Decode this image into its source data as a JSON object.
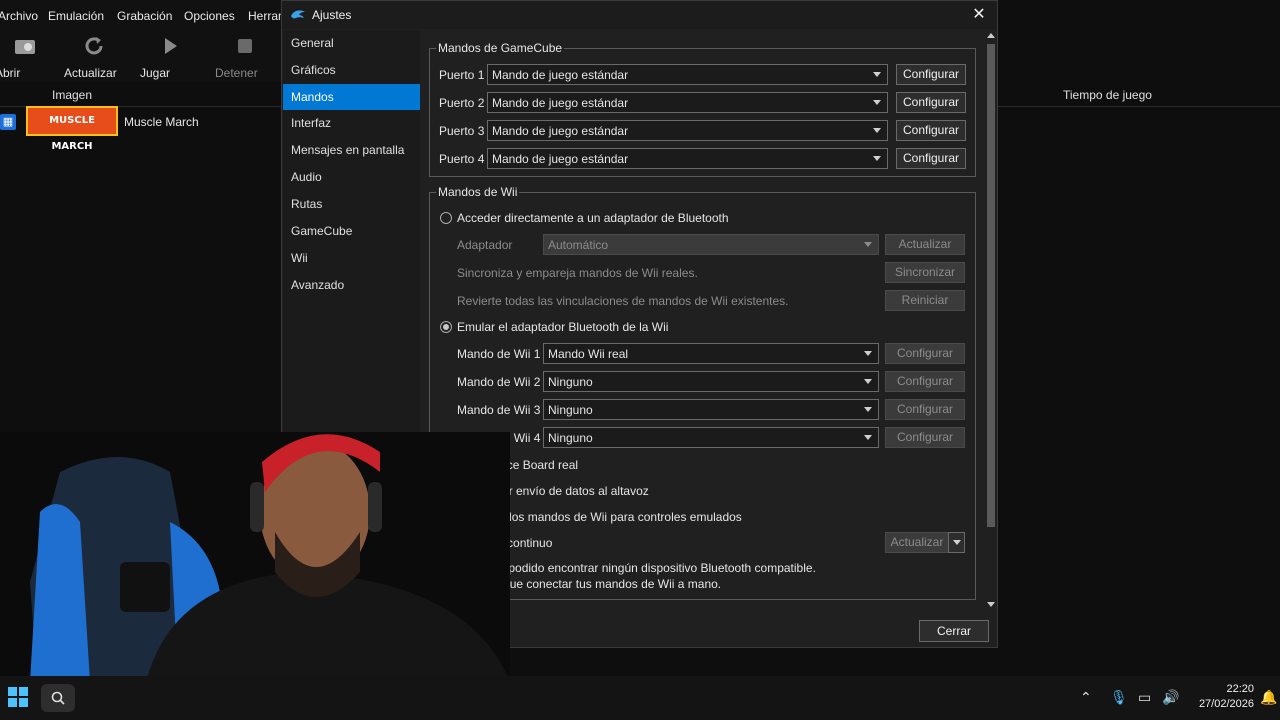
{
  "main_window": {
    "menu": [
      "Archivo",
      "Emulación",
      "Grabación",
      "Opciones",
      "Herram"
    ],
    "toolbar": {
      "open": "Abrir",
      "refresh": "Actualizar",
      "play": "Jugar",
      "stop": "Detener"
    },
    "columns": {
      "image": "Imagen",
      "playtime": "Tiempo de juego"
    },
    "game": {
      "banner_text": "MUSCLE MARCH",
      "title": "Muscle March"
    }
  },
  "dialog": {
    "title": "Ajustes",
    "nav": [
      "General",
      "Gráficos",
      "Mandos",
      "Interfaz",
      "Mensajes en pantalla",
      "Audio",
      "Rutas",
      "GameCube",
      "Wii",
      "Avanzado"
    ],
    "selected_nav": "Mandos",
    "gamecube": {
      "title": "Mandos de GameCube",
      "ports": [
        {
          "label": "Puerto 1",
          "value": "Mando de juego estándar",
          "button": "Configurar"
        },
        {
          "label": "Puerto 2",
          "value": "Mando de juego estándar",
          "button": "Configurar"
        },
        {
          "label": "Puerto 3",
          "value": "Mando de juego estándar",
          "button": "Configurar"
        },
        {
          "label": "Puerto 4",
          "value": "Mando de juego estándar",
          "button": "Configurar"
        }
      ]
    },
    "wii": {
      "title": "Mandos de Wii",
      "passthrough_radio": "Acceder directamente a un adaptador de Bluetooth",
      "adapter_label": "Adaptador",
      "adapter_value": "Automático",
      "adapter_button": "Actualizar",
      "sync_text": "Sincroniza y empareja mandos de Wii reales.",
      "sync_button": "Sincronizar",
      "reset_text": "Revierte todas las vinculaciones de mandos de Wii existentes.",
      "reset_button": "Reiniciar",
      "emulate_radio": "Emular el adaptador Bluetooth de la Wii",
      "remotes": [
        {
          "label": "Mando de Wii 1",
          "value": "Mando Wii real",
          "button": "Configurar"
        },
        {
          "label": "Mando de Wii 2",
          "value": "Ninguno",
          "button": "Configurar"
        },
        {
          "label": "Mando de Wii 3",
          "value": "Ninguno",
          "button": "Configurar"
        },
        {
          "label": "Mando de Wii 4",
          "value": "Ninguno",
          "button": "Configurar"
        }
      ],
      "balance_board": "Balance Board real",
      "speaker_data": "Activar envío de datos al altavoz",
      "connect_emulated": "Conectar los mandos de Wii para controles emulados",
      "continuous_scan": "Escaneo continuo",
      "scan_button": "Actualizar",
      "no_device_line1": "No se ha podido encontrar ningún dispositivo Bluetooth compatible.",
      "no_device_line2": "Tendrás que conectar tus mandos de Wii a mano."
    },
    "close_button": "Cerrar"
  },
  "taskbar": {
    "time": "22:20",
    "date": "27/02/2026"
  },
  "colors": {
    "accent": "#0078d4",
    "dialog_bg": "#202020",
    "nav_bg": "#1b1b1b"
  }
}
